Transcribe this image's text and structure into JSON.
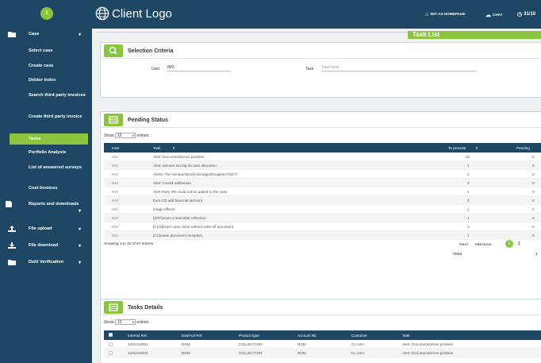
{
  "header": {
    "logo": "Client Logo",
    "set_homepage": "SET AS HOMEPAGE",
    "chat": "CHAT",
    "date": "31/10"
  },
  "sidebar": {
    "avatar_letter": "I",
    "case": "Case",
    "items": [
      {
        "label": "Select case"
      },
      {
        "label": "Create case"
      },
      {
        "label": "Debtor Index"
      },
      {
        "label": "Search third party invoices"
      },
      {
        "label": "Create third party invoice"
      },
      {
        "label": "Tasks"
      },
      {
        "label": "Portfolio Analysis"
      },
      {
        "label": "List of answered surveys"
      },
      {
        "label": "Cost Invoices"
      }
    ],
    "reports": "Reports and downloads",
    "file_upload": "File upload",
    "file_download": "File download",
    "debt_verification": "Debt Verification"
  },
  "page": {
    "tab_title": "Task List"
  },
  "selection": {
    "title": "Selection Criteria",
    "user_label": "User",
    "user_value": "IMX",
    "task_label": "Task",
    "task_placeholder": "Type here..."
  },
  "pending": {
    "title": "Pending Status",
    "show_label": "Show",
    "show_value": "10",
    "entries_label": "entries",
    "columns": [
      "User",
      "Task",
      "To process",
      "Pending"
    ],
    "rows": [
      {
        "user": "IMX",
        "task": "Alert: DocumentServer problem",
        "to_process": "22",
        "pending": "0"
      },
      {
        "user": "IMX",
        "task": "Alert: amount too big for auto allocation",
        "to_process": "1",
        "pending": "0"
      },
      {
        "user": "IMX",
        "task": "Alerte: File /senam/intra/imx/images/images/A7027Y",
        "to_process": "2",
        "pending": "0"
      },
      {
        "user": "IMX",
        "task": "Alert: Invalid addresses",
        "to_process": "3",
        "pending": "0"
      },
      {
        "user": "IMX",
        "task": "Alert:Party SR could not be added to the case",
        "to_process": "1",
        "pending": "0"
      },
      {
        "user": "IMX",
        "task": "Exm CO add financial element",
        "to_process": "3",
        "pending": "0"
      },
      {
        "user": "IMX",
        "task": "Image effecte",
        "to_process": "1",
        "pending": "0"
      },
      {
        "user": "IMX",
        "task": "[SPF]exam 3 amicable collection",
        "to_process": "1",
        "pending": "0"
      },
      {
        "user": "IMX",
        "task": "[CLO]exam case close without write-off document",
        "to_process": "1",
        "pending": "0"
      },
      {
        "user": "IMX",
        "task": "[CC]exam document reception",
        "to_process": "1",
        "pending": "0"
      }
    ],
    "showing": "Showing 1 to 10 of 57 entries",
    "first": "FIRST",
    "previous": "PREVIOUS",
    "page_current": "1",
    "page_next": "2",
    "total_label": "Total",
    "total_value": "1"
  },
  "details": {
    "title": "Tasks Details",
    "show_label": "Show",
    "show_value": "10",
    "entries_label": "entries",
    "columns": [
      "Internal Ref.",
      "External Ref.",
      "Product type",
      "Account Nb",
      "Customer",
      "Task"
    ],
    "rows": [
      {
        "internal": "1401010001",
        "external": "DOM",
        "product": "COLLECTION",
        "account": "DOM",
        "customer": "CL USA",
        "task": "Alert: DocumentServer problem"
      },
      {
        "internal": "1401010001",
        "external": "DOM",
        "product": "COLLECTION",
        "account": "DOM",
        "customer": "CL USA",
        "task": "Alert: DocumentServer problem"
      }
    ]
  }
}
